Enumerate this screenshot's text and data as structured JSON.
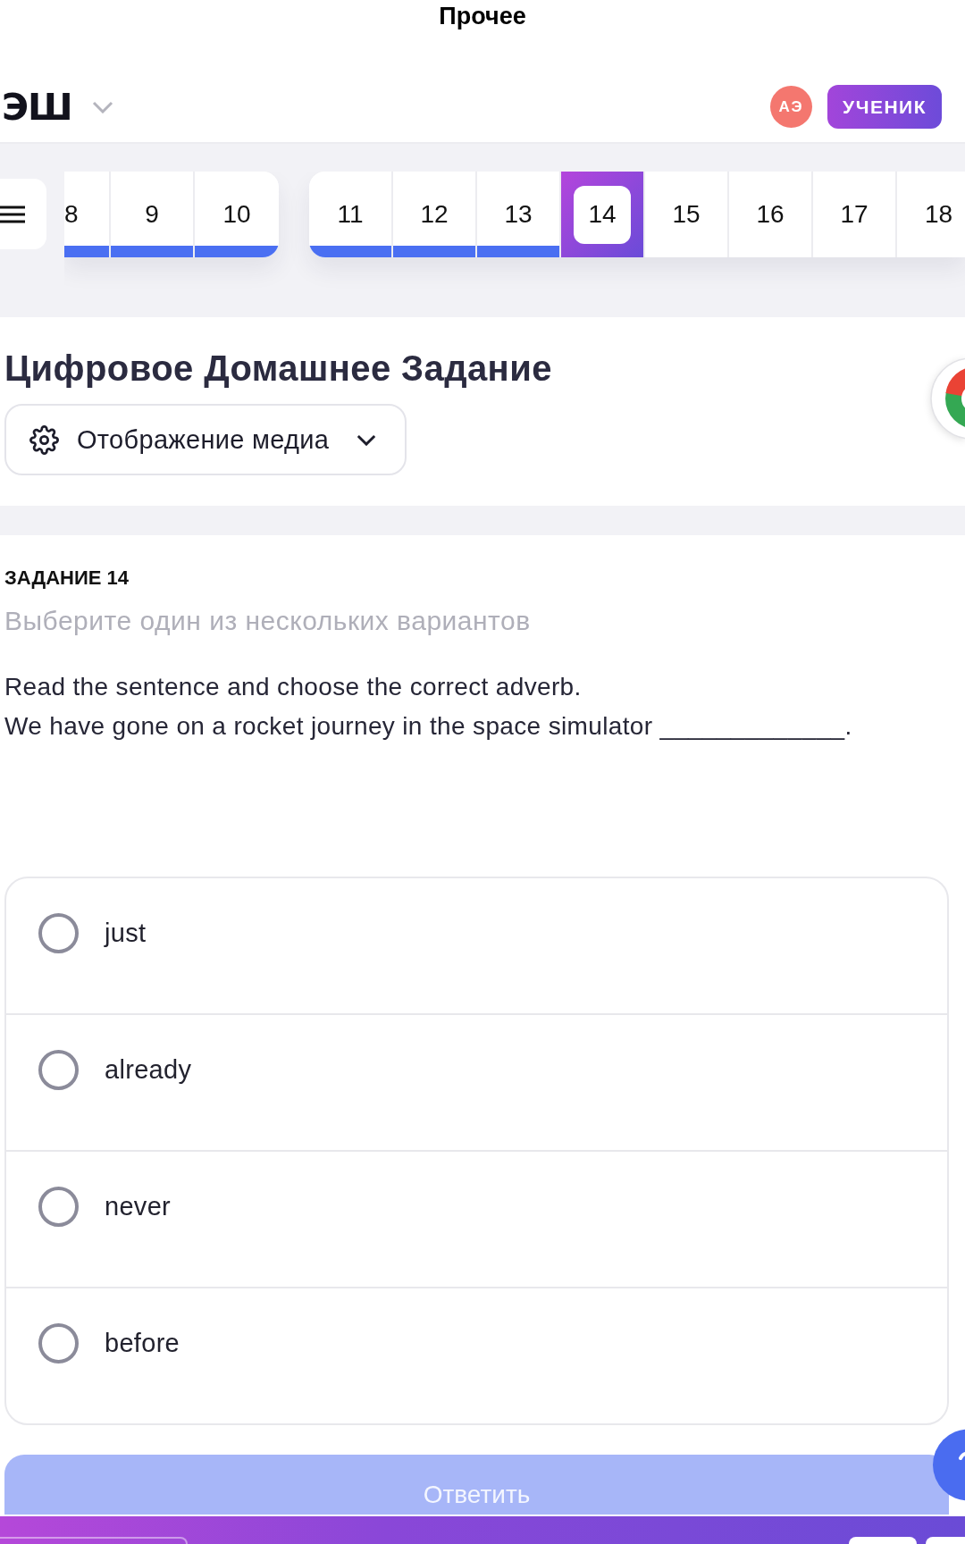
{
  "top_bar": {
    "title": "Прочее"
  },
  "header": {
    "logo": "ЭШ",
    "avatar_initials": "АЭ",
    "role": "УЧЕНИК"
  },
  "question_nav": {
    "groups": [
      {
        "items": [
          {
            "label": "8",
            "done": true,
            "selected": false
          },
          {
            "label": "9",
            "done": true,
            "selected": false
          },
          {
            "label": "10",
            "done": true,
            "selected": false
          }
        ]
      },
      {
        "items": [
          {
            "label": "11",
            "done": true,
            "selected": false
          },
          {
            "label": "12",
            "done": true,
            "selected": false
          },
          {
            "label": "13",
            "done": true,
            "selected": false
          },
          {
            "label": "14",
            "done": false,
            "selected": true
          },
          {
            "label": "15",
            "done": false,
            "selected": false
          },
          {
            "label": "16",
            "done": false,
            "selected": false
          },
          {
            "label": "17",
            "done": false,
            "selected": false
          },
          {
            "label": "18",
            "done": false,
            "selected": false
          }
        ]
      }
    ]
  },
  "assignment": {
    "title": "Цифровое Домашнее Задание",
    "media_dropdown": {
      "label": "Отображение медиа",
      "expanded": false
    }
  },
  "task": {
    "number_label": "ЗАДАНИЕ 14",
    "instruction": "Выберите один из нескольких вариантов",
    "question": [
      "Read the sentence and choose the correct adverb.",
      "We have gone on a rocket journey in the space simulator _____________."
    ],
    "options": [
      {
        "label": "just",
        "selected": false
      },
      {
        "label": "already",
        "selected": false
      },
      {
        "label": "never",
        "selected": false
      },
      {
        "label": "before",
        "selected": false
      }
    ],
    "submit": {
      "label": "Ответить",
      "disabled": true
    }
  }
}
